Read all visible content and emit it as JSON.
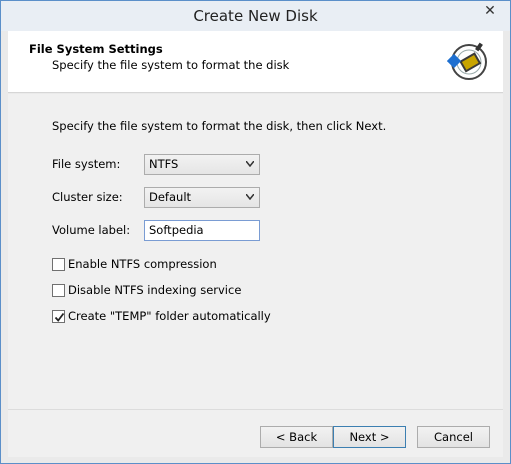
{
  "window": {
    "title": "Create New Disk",
    "close_glyph": "✕"
  },
  "header": {
    "title": "File System Settings",
    "subtitle": "Specify the file system to format the disk",
    "icon": "disk-wizard-icon"
  },
  "main": {
    "instruction": "Specify the file system to format the disk, then click Next.",
    "file_system": {
      "label": "File system:",
      "value": "NTFS"
    },
    "cluster_size": {
      "label": "Cluster size:",
      "value": "Default"
    },
    "volume_label": {
      "label": "Volume label:",
      "value": "Softpedia"
    },
    "checkboxes": [
      {
        "label": "Enable NTFS compression",
        "checked": false
      },
      {
        "label": "Disable NTFS indexing service",
        "checked": false
      },
      {
        "label": "Create \"TEMP\" folder automatically",
        "checked": true
      }
    ]
  },
  "footer": {
    "back_label": "< Back",
    "next_label": "Next >",
    "cancel_label": "Cancel"
  }
}
